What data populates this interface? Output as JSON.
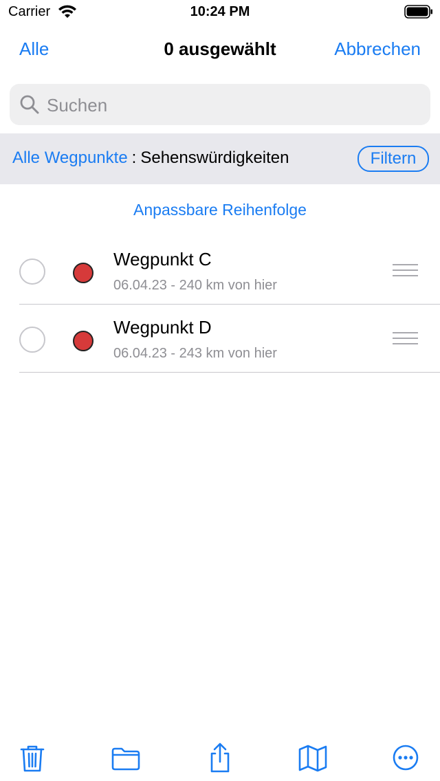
{
  "status": {
    "carrier": "Carrier",
    "time": "10:24 PM"
  },
  "nav": {
    "left": "Alle",
    "title": "0 ausgewählt",
    "right": "Abbrechen"
  },
  "search": {
    "placeholder": "Suchen",
    "value": ""
  },
  "filter": {
    "link": "Alle Wegpunkte",
    "separator": ":",
    "current": "Sehenswürdigkeiten",
    "button": "Filtern"
  },
  "sort_label": "Anpassbare Reihenfolge",
  "items": [
    {
      "title": "Wegpunkt C",
      "subtitle": "06.04.23 - 240 km von hier",
      "color": "#d63a3a"
    },
    {
      "title": "Wegpunkt D",
      "subtitle": "06.04.23 - 243 km von hier",
      "color": "#d63a3a"
    }
  ],
  "toolbar": [
    "trash-icon",
    "folder-icon",
    "share-icon",
    "map-icon",
    "more-icon"
  ],
  "accent": "#1a7cf2"
}
